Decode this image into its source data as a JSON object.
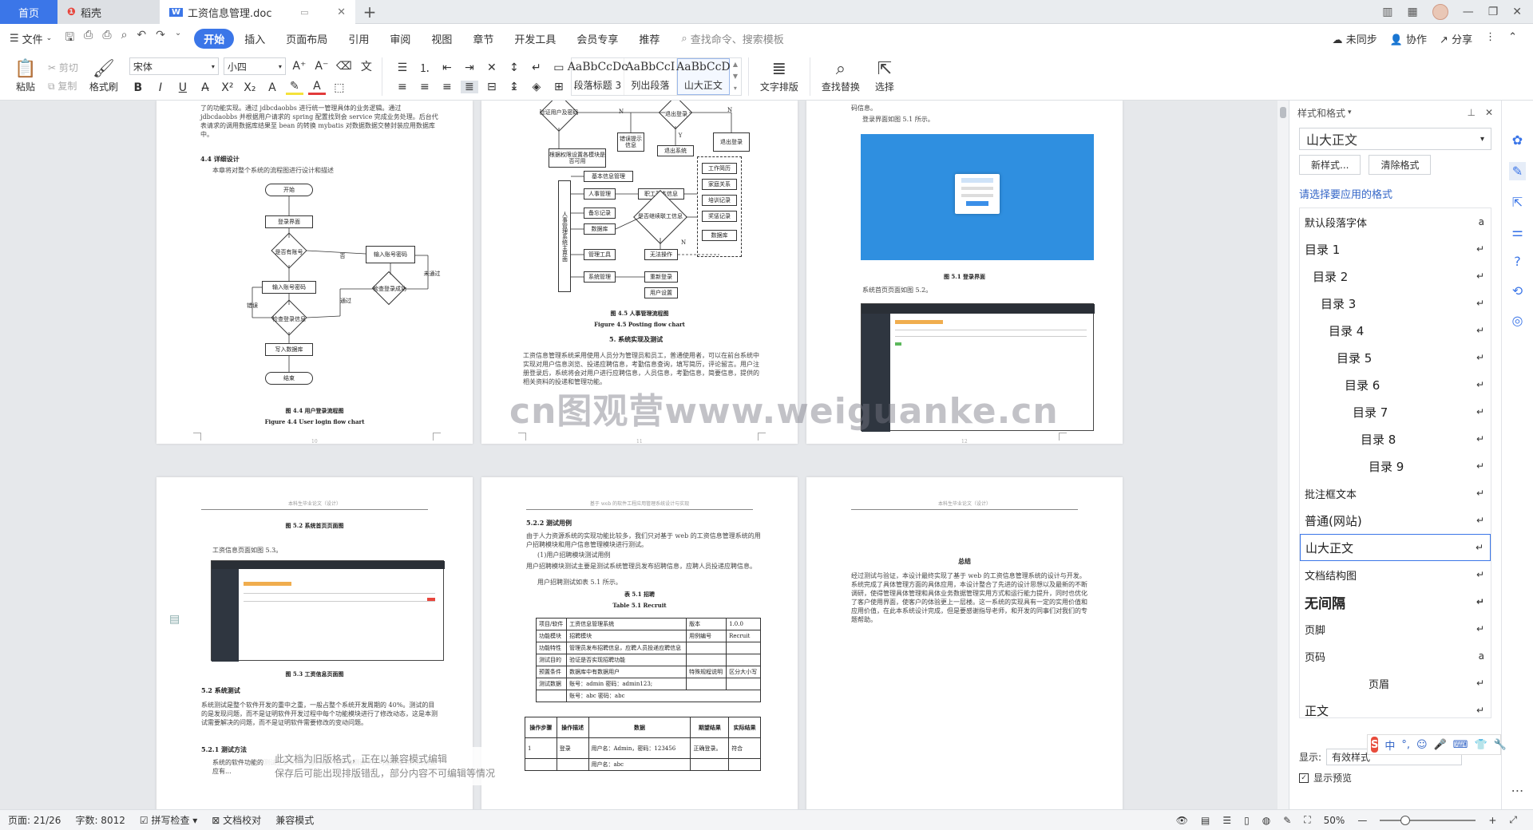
{
  "tabs": {
    "home": "首页",
    "docer": "稻壳",
    "doc": "工资信息管理.doc"
  },
  "menu": {
    "file": "文件",
    "items": [
      "开始",
      "插入",
      "页面布局",
      "引用",
      "审阅",
      "视图",
      "章节",
      "开发工具",
      "会员专享",
      "推荐"
    ],
    "search": "查找命令、搜索模板",
    "right": [
      "未同步",
      "协作",
      "分享"
    ]
  },
  "ribbon": {
    "paste": "粘贴",
    "cut": "剪切",
    "copy": "复制",
    "format_painter": "格式刷",
    "font_name": "宋体",
    "font_size": "小四",
    "styles": [
      {
        "preview": "AaBbCcDc",
        "name": "段落标题 3"
      },
      {
        "preview": "AaBbCcI",
        "name": "列出段落"
      },
      {
        "preview": "AaBbCcD",
        "name": "山大正文"
      }
    ],
    "text_layout": "文字排版",
    "find_replace": "查找替换",
    "select": "选择"
  },
  "doc": {
    "p1": {
      "top_text": "了的功能实现。通过 jdbcdaobbs 进行统一管理具体的业务逻辑。通过 jdbcdaobbs 并根据用户请求的 spring 配置找到会 service 完成业务处理。后台代表请求的调用数据库结果至 bean 的转换 mybatis 对数据数据交替封装应用数据库中。",
      "section": "4.4 详细设计",
      "section_text": "本章将对整个系统的流程图进行设计和描述",
      "flow": {
        "start": "开始",
        "login_ui": "登录界面",
        "has_account": "是否有账号",
        "no": "否",
        "input_reg": "输入账号密码",
        "input": "输入账号密码",
        "check_reg": "检查登录成功",
        "fail": "错误",
        "check": "检查登录信息",
        "write": "写入数据库",
        "end": "结束",
        "pass": "通过",
        "not_pass": "未通过"
      },
      "caption_cn": "图 4.4 用户登录流程图",
      "caption_en": "Figure 4.4 User login flow chart",
      "page_no": "10"
    },
    "p2": {
      "flow": {
        "verify": "验证用户及密码",
        "n": "N",
        "error": "错误提示信息",
        "exit_login": "退出登录",
        "exit_sys": "退出系统",
        "y": "Y",
        "exit_box": "退出登录",
        "menu_by_role": "根据权限设置各模块是否可用",
        "system_main": "人事管理系统主界面",
        "basic": "基本信息管理",
        "hr": "人事管理",
        "emp_info": "职工基本信息",
        "attendance": "备忘记录",
        "database": "数据库",
        "tools": "管理工具",
        "sys": "系统管理",
        "relogin": "重新登录",
        "user_set": "用户设置",
        "decision": "是否继续联工信息",
        "no_op": "无法操作",
        "work": "工作简历",
        "family": "家庭关系",
        "training": "培训记录",
        "reward": "奖惩记录",
        "datatbl": "数据库"
      },
      "caption_cn": "图 4.5 人事管理流程图",
      "caption_en": "Figure 4.5 Posting flow chart",
      "section": "5. 系统实现及测试",
      "text": "工资信息管理系统采用使用人员分为管理员和员工，普通使用者，可以在前台系统中实现对用户信息浏览、投递应聘信息，考勤信息查询，填写简历，评论留言。用户注册登录后，系统将会对用户进行应聘信息，人员信息，考勤信息，简要信息，提供的相关资料的投递和管理功能。",
      "page_no": "11"
    },
    "p3": {
      "top": "码信息。",
      "intro": "登录界面如图 5.1 所示。",
      "caption1": "图 5.1 登录界面",
      "intro2": "系统首页页面如图 5.2。",
      "page_no": "12"
    },
    "p4": {
      "header": "本科生毕业论文（设计）",
      "caption_top": "图 5.2 系统首页页面图",
      "intro": "工资信息页面如图 5.3。",
      "caption": "图 5.3 工资信息页面图",
      "section": "5.2 系统测试",
      "text": "系统测试是整个软件开发的重中之重，一般占整个系统开发周期的 40%。测试的目的是发现问题，而不是证明软件开发过程中每个功能模块进行了修改动态，这是本测试需要解决的问题，而不是证明软件需要修改的变动问题。",
      "section2": "5.2.1 测试方法",
      "text2": "系统的软件功能的测试主要采用黑盒测试，在黑盒测试中不可能模拟有所的测试应有..."
    },
    "p5": {
      "header": "基于 web 的软件工程应用管理系统设计与实现",
      "section": "5.2.2 测试用例",
      "text": "由于人力资源系统的实现功能比较多，我们只对基于 web 的工资信息管理系统的用户招聘模块和用户信息管理模块进行测试。",
      "item": "(1)用户招聘模块测试用例",
      "item_text": "用户招聘模块测试主要是测试系统管理员发布招聘信息，应聘人员投递应聘信息。",
      "item_text2": "用户招聘测试如表 5.1 所示。",
      "table_caption_cn": "表 5.1 招聘",
      "table_caption_en": "Table 5.1 Recruit",
      "table_rows": [
        [
          "项目/软件",
          "工资信息管理系统",
          "版本",
          "1.0.0"
        ],
        [
          "功能模块",
          "招聘模块",
          "用例编号",
          "Recruit"
        ],
        [
          "功能特性",
          "管理员发布招聘信息，应聘人员投递应聘信息",
          "",
          ""
        ],
        [
          "测试目的",
          "验证是否实现招聘功能",
          "",
          ""
        ],
        [
          "预置条件",
          "数据库中有数据用户",
          "特殊规程说明",
          "区分大小写"
        ],
        [
          "测试数据",
          "账号：admin 密码：admin123;",
          "",
          ""
        ]
      ],
      "table_row_extra": "账号：abc   密码：abc",
      "table_head": [
        "操作步骤",
        "操作描述",
        "数据",
        "期望结果",
        "实际结果"
      ],
      "table_row1": [
        "1",
        "登录",
        "用户名：Admin，密码：123456",
        "正确登录。",
        "符合"
      ],
      "table_row2_data": "用户名：abc"
    },
    "p6": {
      "header": "本科生毕业论文（设计）",
      "title": "总结",
      "text": "经过测试与验证，本设计最终实现了基于 web 的工资信息管理系统的设计与开发。系统完成了具体管理方面的具体应用，本设计整合了先进的设计思想以及最新的不断调研，使得管理具体管理和具体业务数据管理实用方式和运行能力提升，同时也优化了客户使用界面，使客户的体验更上一层楼。这一系统的实现具有一定的实用价值和应用价值，在此本系统设计完成，但是要感谢指导老师，和开发的同事们对我们的专题帮助。"
    },
    "watermark": "cn图观营www.weiguanke.cn",
    "compat_line1": "此文档为旧版格式，正在以兼容模式编辑",
    "compat_line2": "保存后可能出现排版错乱，部分内容不可编辑等情况"
  },
  "panel": {
    "title": "样式和格式",
    "current": "山大正文",
    "new_style": "新样式...",
    "clear": "清除格式",
    "choose": "请选择要应用的格式",
    "styles": [
      {
        "name": "默认段落字体",
        "mark": "a",
        "indent": 0
      },
      {
        "name": "目录 1",
        "mark": "↵",
        "indent": 0
      },
      {
        "name": "目录 2",
        "mark": "↵",
        "indent": 10
      },
      {
        "name": "目录 3",
        "mark": "↵",
        "indent": 20
      },
      {
        "name": "目录 4",
        "mark": "↵",
        "indent": 30
      },
      {
        "name": "目录 5",
        "mark": "↵",
        "indent": 40
      },
      {
        "name": "目录 6",
        "mark": "↵",
        "indent": 50
      },
      {
        "name": "目录 7",
        "mark": "↵",
        "indent": 60
      },
      {
        "name": "目录 8",
        "mark": "↵",
        "indent": 70
      },
      {
        "name": "目录 9",
        "mark": "↵",
        "indent": 80
      },
      {
        "name": "批注框文本",
        "mark": "↵",
        "indent": 0
      },
      {
        "name": "普通(网站)",
        "mark": "↵",
        "indent": 0
      },
      {
        "name": "山大正文",
        "mark": "↵",
        "indent": 0
      },
      {
        "name": "文档结构图",
        "mark": "↵",
        "indent": 0
      },
      {
        "name": "无间隔",
        "mark": "↵",
        "indent": 0
      },
      {
        "name": "页脚",
        "mark": "↵",
        "indent": 0
      },
      {
        "name": "页码",
        "mark": "a",
        "indent": 0
      },
      {
        "name": "页眉",
        "mark": "↵",
        "indent": 80
      },
      {
        "name": "正文",
        "mark": "↵",
        "indent": 0
      }
    ],
    "show_label": "显示:",
    "show_value": "有效样式",
    "preview": "显示预览"
  },
  "ime": {
    "logo": "S",
    "items": [
      "中",
      "°,",
      "☺",
      "🎤",
      "⌨",
      "👕",
      "🔧"
    ]
  },
  "status": {
    "page": "页面: 21/26",
    "words": "字数: 8012",
    "spell": "拼写检查",
    "proof": "文档校对",
    "compat": "兼容模式",
    "zoom": "50%"
  }
}
